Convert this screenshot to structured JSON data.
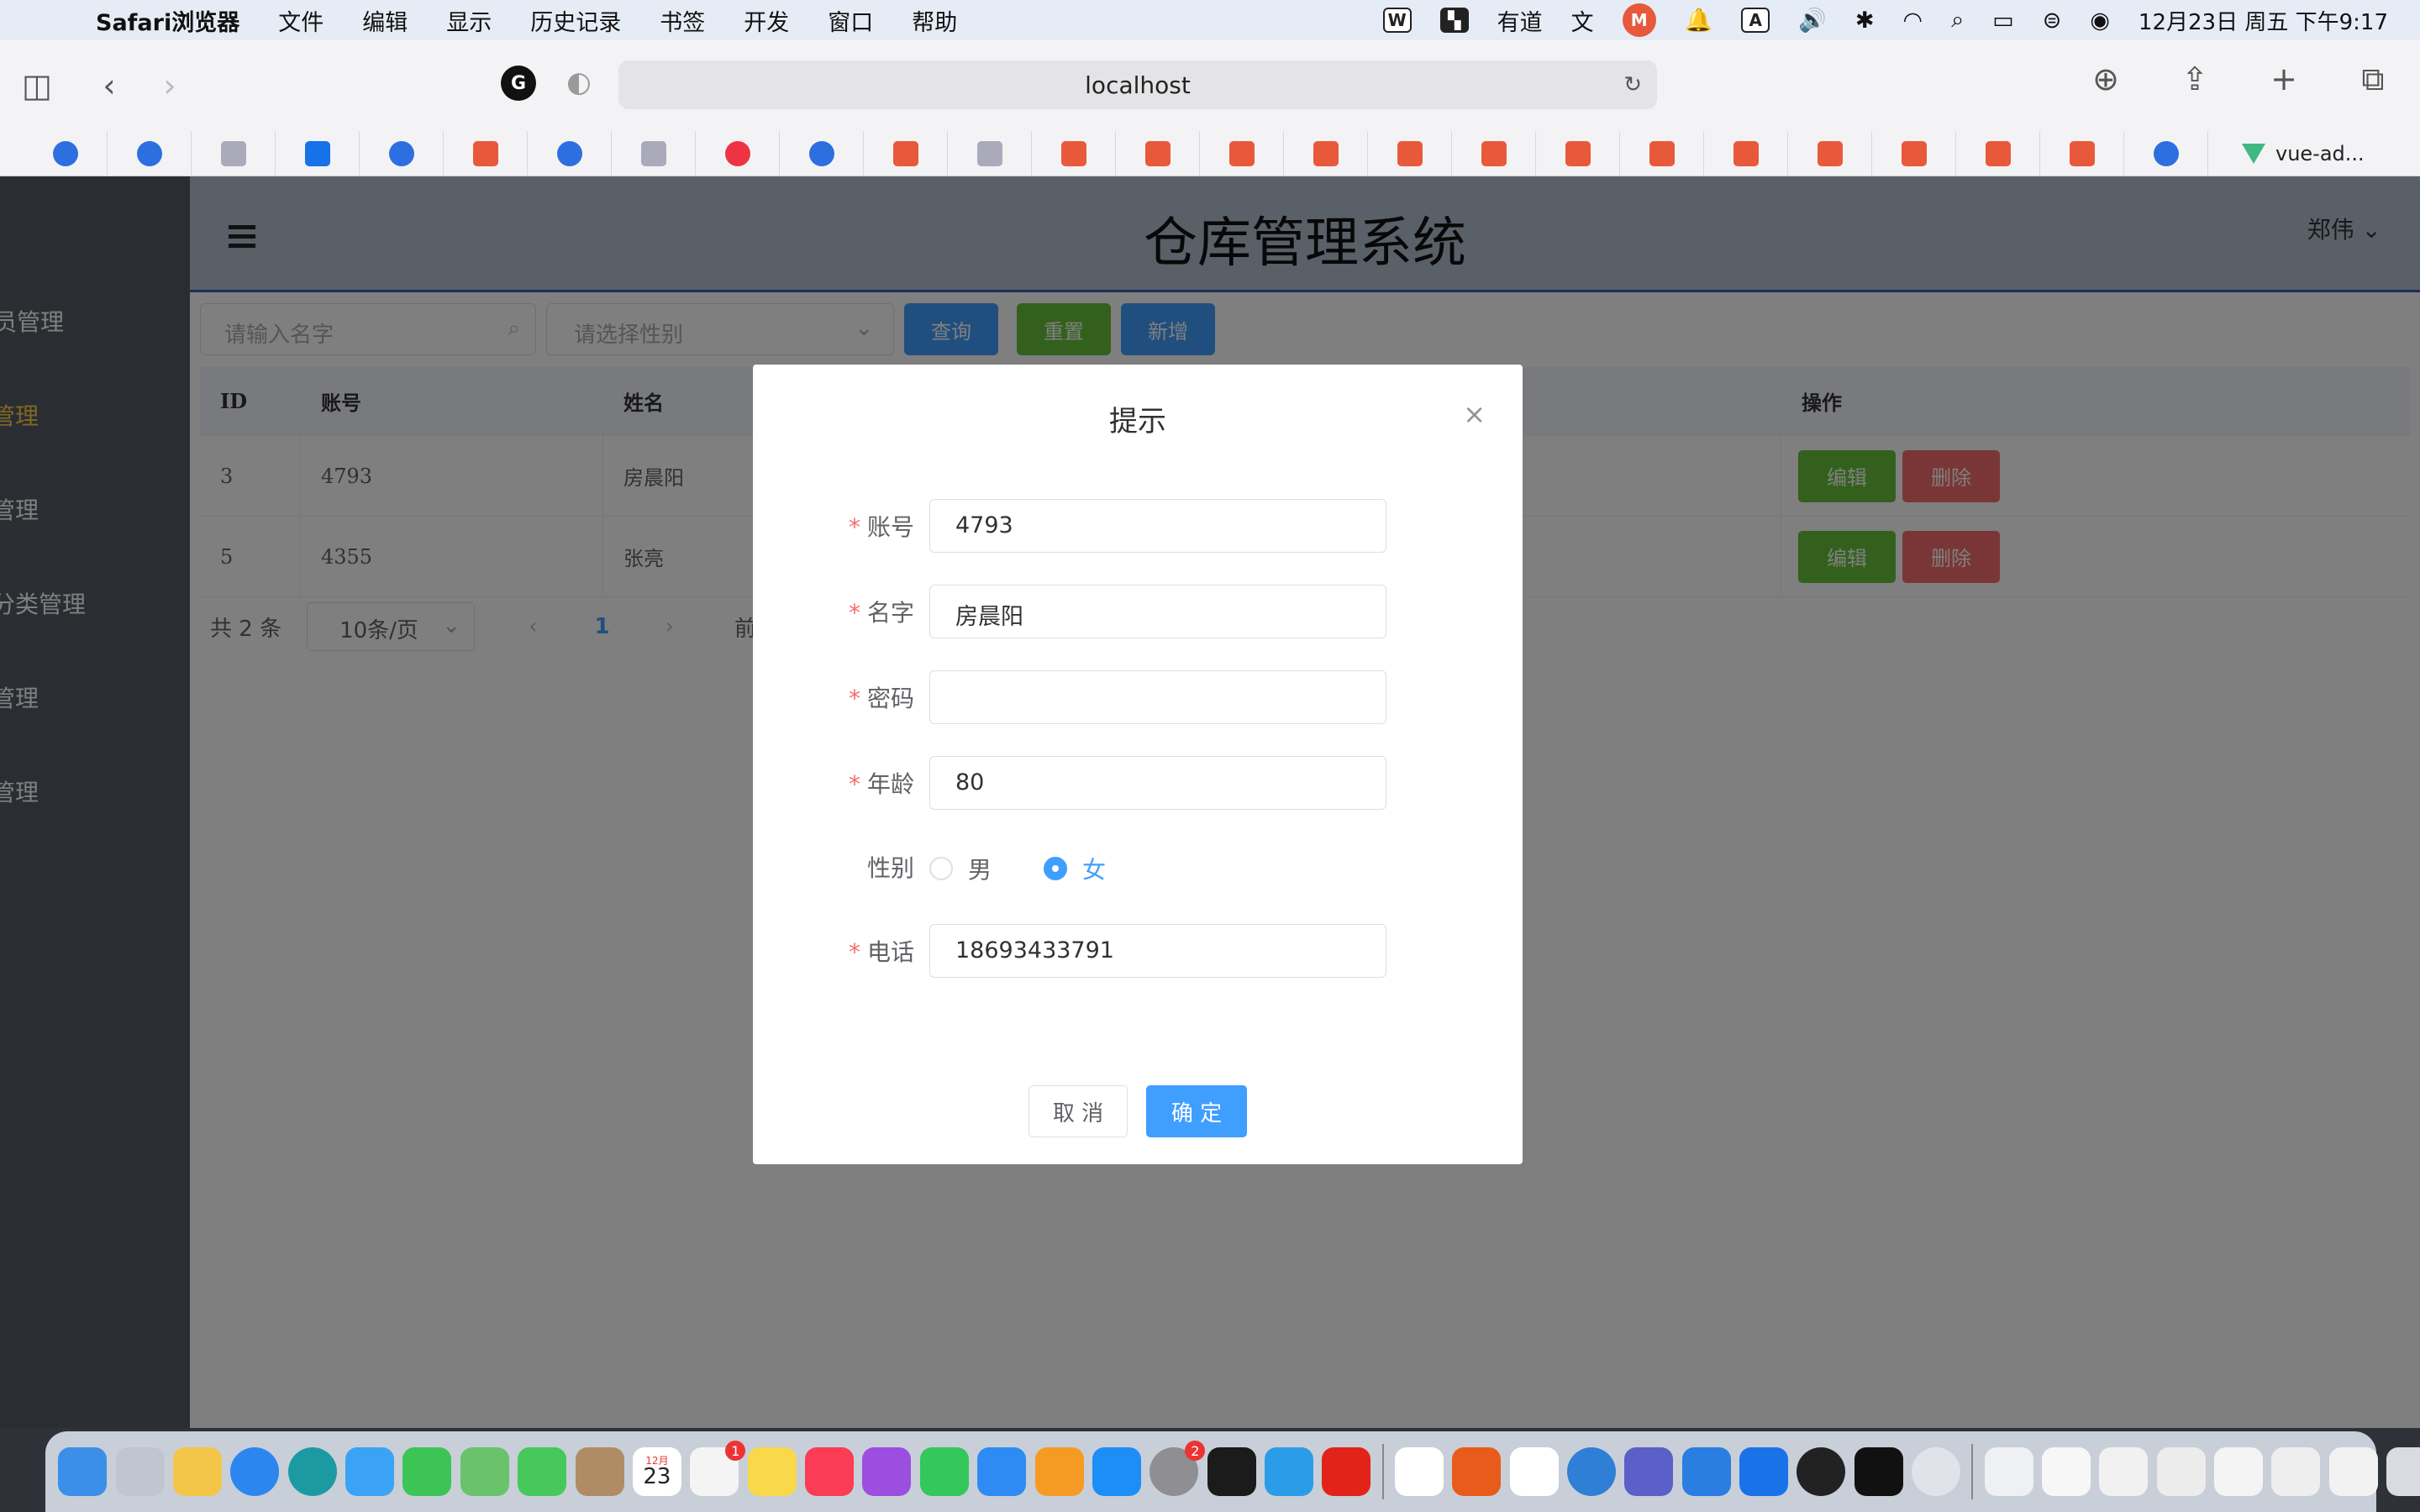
{
  "menubar": {
    "app_name": "Safari浏览器",
    "items": [
      "文件",
      "编辑",
      "显示",
      "历史记录",
      "书签",
      "开发",
      "窗口",
      "帮助"
    ],
    "youdao": "有道",
    "wen": "文",
    "datetime": "12月23日 周五 下午9:17"
  },
  "browser": {
    "url": "localhost",
    "bookmarks_last": "vue-ad..."
  },
  "app": {
    "title": "仓库管理系统",
    "user": "郑伟",
    "user_chevron": "⌄",
    "sidebar": [
      "员管理",
      "管理",
      "管理",
      "分类管理",
      "管理",
      "管理"
    ],
    "active_sidebar_index": 1
  },
  "toolbar": {
    "name_placeholder": "请输入名字",
    "gender_placeholder": "请选择性别",
    "query": "查询",
    "reset": "重置",
    "add": "新增"
  },
  "table": {
    "headers": {
      "id": "ID",
      "account": "账号",
      "name": "姓名",
      "ops": "操作"
    },
    "rows": [
      {
        "id": "3",
        "account": "4793",
        "name": "房晨阳",
        "edit": "编辑",
        "delete": "删除"
      },
      {
        "id": "5",
        "account": "4355",
        "name": "张亮",
        "edit": "编辑",
        "delete": "删除"
      }
    ]
  },
  "pagination": {
    "total": "共 2 条",
    "size": "10条/页",
    "page": "1",
    "goto": "前往"
  },
  "dialog": {
    "title": "提示",
    "close": "×",
    "required_mark": "*",
    "fields": {
      "account_label": "账号",
      "account_value": "4793",
      "name_label": "名字",
      "name_value": "房晨阳",
      "password_label": "密码",
      "password_value": "",
      "age_label": "年龄",
      "age_value": "80",
      "gender_label": "性别",
      "male": "男",
      "female": "女",
      "phone_label": "电话",
      "phone_value": "18693433791"
    },
    "gender_selected": "女",
    "cancel": "取 消",
    "confirm": "确 定"
  },
  "dock": {
    "calendar_day": "23",
    "calendar_month": "12月",
    "reminders_badge": "1",
    "settings_badge": "2"
  },
  "colors": {
    "primary": "#409eff",
    "success": "#67c23a",
    "danger": "#f56c6c",
    "aside": "#545c64",
    "header": "#b3c0d1",
    "active_menu": "#ffd04b"
  }
}
